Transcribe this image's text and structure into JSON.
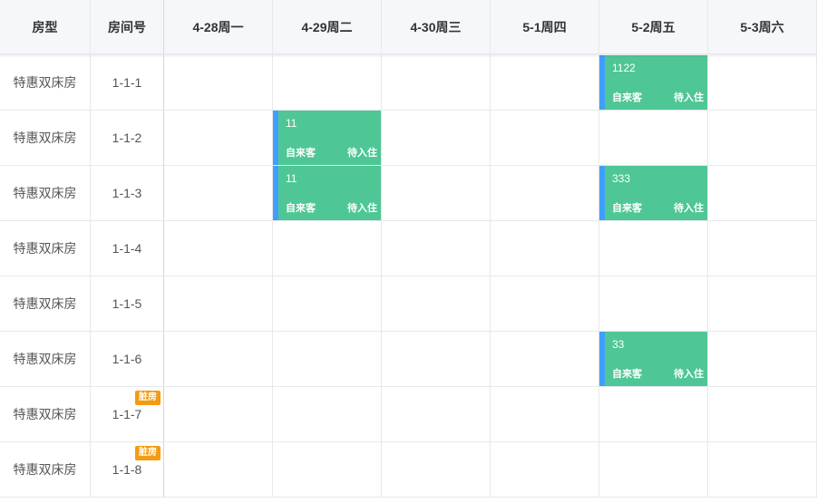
{
  "header": {
    "room_type": "房型",
    "room_number": "房间号",
    "dates": [
      "4-28周一",
      "4-29周二",
      "4-30周三",
      "5-1周四",
      "5-2周五",
      "5-3周六"
    ]
  },
  "rooms": [
    {
      "type": "特惠双床房",
      "number": "1-1-1",
      "dirty": ""
    },
    {
      "type": "特惠双床房",
      "number": "1-1-2",
      "dirty": ""
    },
    {
      "type": "特惠双床房",
      "number": "1-1-3",
      "dirty": ""
    },
    {
      "type": "特惠双床房",
      "number": "1-1-4",
      "dirty": ""
    },
    {
      "type": "特惠双床房",
      "number": "1-1-5",
      "dirty": ""
    },
    {
      "type": "特惠双床房",
      "number": "1-1-6",
      "dirty": ""
    },
    {
      "type": "特惠双床房",
      "number": "1-1-7",
      "dirty": "脏房"
    },
    {
      "type": "特惠双床房",
      "number": "1-1-8",
      "dirty": "脏房"
    }
  ],
  "bookings": [
    {
      "room": 0,
      "day": 4,
      "name": "1122",
      "source": "自来客",
      "status": "待入住"
    },
    {
      "room": 1,
      "day": 1,
      "name": "11",
      "source": "自来客",
      "status": "待入住"
    },
    {
      "room": 2,
      "day": 1,
      "name": "11",
      "source": "自来客",
      "status": "待入住"
    },
    {
      "room": 2,
      "day": 4,
      "name": "333",
      "source": "自来客",
      "status": "待入住"
    },
    {
      "room": 5,
      "day": 4,
      "name": "33",
      "source": "自来客",
      "status": "待入住"
    }
  ],
  "colors": {
    "booking_fill": "#4fc695",
    "booking_accent": "#409eff",
    "dirty_badge": "#f39c12",
    "header_bg": "#f5f7fa"
  }
}
